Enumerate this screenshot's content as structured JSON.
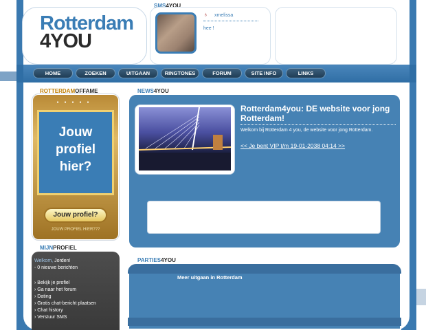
{
  "header": {
    "logo_line1": "Rotterdam",
    "logo_line2": "4YOU",
    "sms_label_a": "SMS",
    "sms_label_b": "4YOU",
    "sms_user": "xmelissa",
    "sms_message": "hee !"
  },
  "nav": [
    "HOME",
    "ZOEKEN",
    "UITGAAN",
    "RINGTONES",
    "FORUM",
    "SITE INFO",
    "LINKS"
  ],
  "fame": {
    "label_a": "ROTTERDAM",
    "label_b": "OFFAME",
    "big_text_1": "Jouw",
    "big_text_2": "profiel",
    "big_text_3": "hier?",
    "button": "Jouw profiel?",
    "sub": "JOUW PROFIEL HIER???"
  },
  "news": {
    "label_a": "NEWS",
    "label_b": "4YOU",
    "title": "Rotterdam4you: DE website voor jong Rotterdam!",
    "text": "Welkom bij Rotterdam 4 you, de website voor jong Rotterdam.",
    "link": "<< Je bent VIP t/m 19-01-2038 04:14 >>"
  },
  "parties": {
    "label_a": "PARTIES",
    "label_b": "4YOU",
    "text": "Meer uitgaan in Rotterdam"
  },
  "profile": {
    "label_a": "MIJN",
    "label_b": "PROFIEL",
    "welcome": "Welkom,",
    "user": "Jorden!",
    "messages": "- 0 nieuwe berichten",
    "links": [
      "› Bekijk je profiel",
      "› Ga naar het forum",
      "› Dating",
      "› Gratis chat-bericht plaatsen",
      "› Chat history",
      "› Verstuur SMS"
    ]
  },
  "colors": {
    "accent": "#3a7db5",
    "gold": "#c07d00"
  }
}
